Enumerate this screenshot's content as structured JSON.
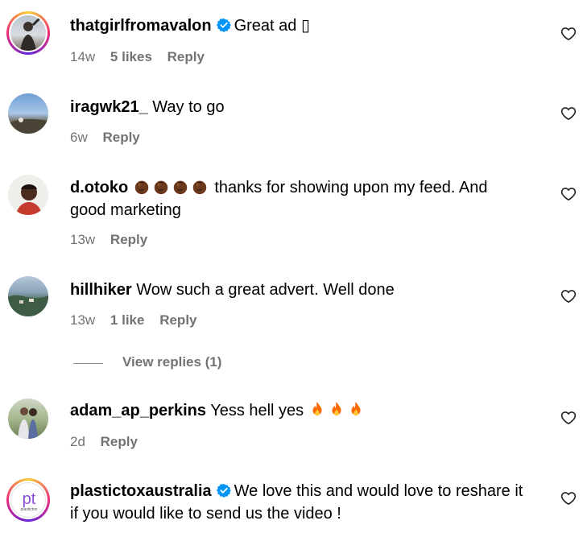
{
  "comments": [
    {
      "username": "thatgirlfromavalon",
      "text": "Great ad ▯",
      "time": "14w",
      "likes": "5 likes",
      "reply": "Reply"
    },
    {
      "username": "iragwk21_",
      "text": "Way to go",
      "time": "6w",
      "reply": "Reply"
    },
    {
      "username": "d.otoko",
      "text_line1": "thanks for showing upon my feed. And",
      "text_line2": "good marketing",
      "time": "13w",
      "reply": "Reply"
    },
    {
      "username": "hillhiker",
      "text": "Wow such a great advert. Well done",
      "time": "13w",
      "likes": "1 like",
      "reply": "Reply",
      "view_replies": "View replies (1)"
    },
    {
      "username": "adam_ap_perkins",
      "text": "Yess hell yes",
      "time": "2d",
      "reply": "Reply"
    },
    {
      "username": "plastictoxaustralia",
      "text_line1": "We love this and would love to reshare it",
      "text_line2": "if you would like to send us the video !",
      "avatar_text": "pt",
      "avatar_subtext": "plastictox"
    }
  ],
  "colors": {
    "verified": "#0095f6",
    "meta": "#737373",
    "fire": "#ff6a00",
    "clap": "#6b3a1e"
  },
  "icons": {
    "like": "heart-icon",
    "verified": "verified-badge-icon",
    "fire": "fire-emoji",
    "clap": "clapping-hands-emoji"
  }
}
